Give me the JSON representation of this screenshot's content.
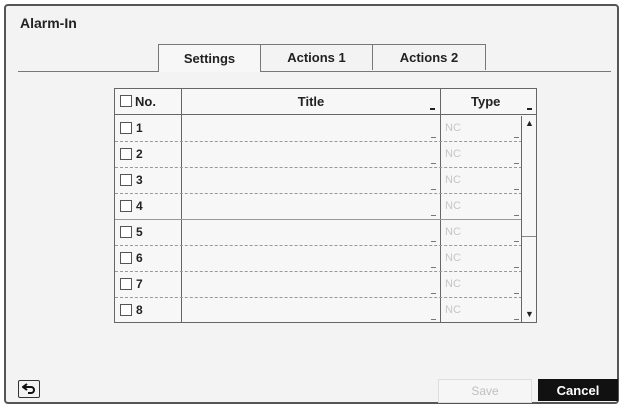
{
  "window": {
    "title": "Alarm-In"
  },
  "tabs": [
    {
      "label": "Settings",
      "active": true
    },
    {
      "label": "Actions 1",
      "active": false
    },
    {
      "label": "Actions 2",
      "active": false
    }
  ],
  "table": {
    "columns": {
      "no": "No.",
      "title": "Title",
      "type": "Type"
    },
    "rows": [
      {
        "no": "1",
        "title": "",
        "type": "NC"
      },
      {
        "no": "2",
        "title": "",
        "type": "NC"
      },
      {
        "no": "3",
        "title": "",
        "type": "NC"
      },
      {
        "no": "4",
        "title": "",
        "type": "NC"
      },
      {
        "no": "5",
        "title": "",
        "type": "NC"
      },
      {
        "no": "6",
        "title": "",
        "type": "NC"
      },
      {
        "no": "7",
        "title": "",
        "type": "NC"
      },
      {
        "no": "8",
        "title": "",
        "type": "NC"
      }
    ]
  },
  "footer": {
    "back_icon": "back-arrow-icon",
    "save_label": "Save",
    "cancel_label": "Cancel",
    "save_enabled": false
  },
  "colors": {
    "cancel_bg": "#111111",
    "disabled_text": "#c0c0c0"
  }
}
